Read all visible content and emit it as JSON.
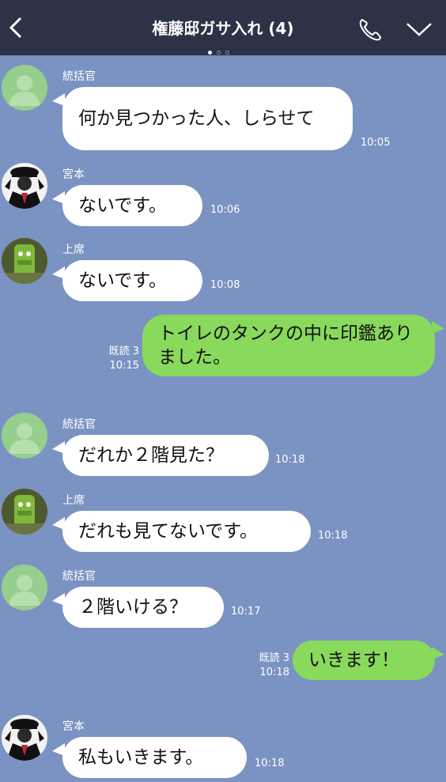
{
  "header": {
    "title": "権藤邸ガサ入れ (4)"
  },
  "colors": {
    "header_bg": "#2d3346",
    "chat_bg": "#7b93c2",
    "incoming_bubble": "#ffffff",
    "outgoing_bubble": "#89d95c"
  },
  "messages": [
    {
      "sender": "統括官",
      "text": "何か見つかった人、しらせて",
      "time": "10:05"
    },
    {
      "sender": "宮本",
      "text": "ないです。",
      "time": "10:06"
    },
    {
      "sender": "上席",
      "text": "ないです。",
      "time": "10:08"
    },
    {
      "sender": "",
      "text": "トイレのタンクの中に印鑑ありました。",
      "time": "10:15",
      "read": "既読 3"
    },
    {
      "sender": "統括官",
      "text": "だれか２階見た？",
      "time": "10:18"
    },
    {
      "sender": "上席",
      "text": "だれも見てないです。",
      "time": "10:18"
    },
    {
      "sender": "統括官",
      "text": "２階いける？",
      "time": "10:17"
    },
    {
      "sender": "",
      "text": "いきます！",
      "time": "10:18",
      "read": "既読 3"
    },
    {
      "sender": "宮本",
      "text": "私もいきます。",
      "time": "10:18"
    }
  ]
}
